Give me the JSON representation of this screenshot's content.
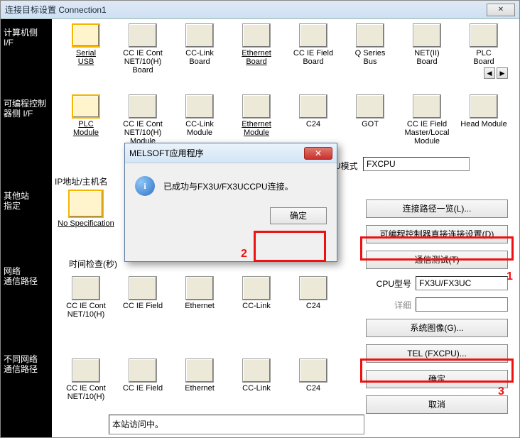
{
  "window": {
    "title": "连接目标设置 Connection1"
  },
  "labels": {
    "computer_if": "计算机侧\nI/F",
    "plc_if": "可编程控制器侧 I/F",
    "other_station": "其他站\n指定",
    "network_route": "网络\n通信路径",
    "diff_network": "不同网络\n通信路径"
  },
  "row1": [
    {
      "label": "Serial\nUSB",
      "selected": true,
      "underline": true
    },
    {
      "label": "CC IE Cont\nNET/10(H)\nBoard"
    },
    {
      "label": "CC-Link\nBoard"
    },
    {
      "label": "Ethernet\nBoard",
      "underline": true
    },
    {
      "label": "CC IE Field\nBoard"
    },
    {
      "label": "Q Series\nBus"
    },
    {
      "label": "NET(II)\nBoard"
    },
    {
      "label": "PLC\nBoard"
    }
  ],
  "row2": [
    {
      "label": "PLC\nModule",
      "underline": true,
      "selected": true
    },
    {
      "label": "CC IE Cont\nNET/10(H)\nModule"
    },
    {
      "label": "CC-Link\nModule"
    },
    {
      "label": "Ethernet\nModule",
      "underline": true
    },
    {
      "label": "C24"
    },
    {
      "label": "GOT"
    },
    {
      "label": "CC IE Field\nMaster/Local\nModule"
    },
    {
      "label": "Head Module"
    }
  ],
  "row3": [
    {
      "label": "No Specification",
      "underline": true,
      "selected": true
    }
  ],
  "row4": [
    {
      "label": "CC IE Cont\nNET/10(H)"
    },
    {
      "label": "CC IE Field"
    },
    {
      "label": "Ethernet"
    },
    {
      "label": "CC-Link"
    },
    {
      "label": "C24"
    }
  ],
  "row5": [
    {
      "label": "CC IE Cont\nNET/10(H)"
    },
    {
      "label": "CC IE Field"
    },
    {
      "label": "Ethernet"
    },
    {
      "label": "CC-Link"
    },
    {
      "label": "C24"
    }
  ],
  "fields": {
    "ip_label": "IP地址/主机名",
    "cpu_mode_label": "PU模式",
    "cpu_mode_value": "FXCPU",
    "time_check_label": "时间检查(秒)"
  },
  "right": {
    "conn_route_list": "连接路径一览(L)...",
    "plc_direct_conn": "可编程控制器直接连接设置(D)",
    "comm_test": "通信测试(T)",
    "cpu_model_label": "CPU型号",
    "cpu_model_value": "FX3U/FX3UC",
    "detail_label": "详细",
    "sys_image": "系统图像(G)...",
    "tel": "TEL (FXCPU)...",
    "ok": "确定",
    "cancel": "取消"
  },
  "dialog": {
    "title": "MELSOFT应用程序",
    "message": "已成功与FX3U/FX3UCCPU连接。",
    "ok": "确定"
  },
  "bottom": {
    "text": "本站访问中。"
  },
  "annotations": {
    "n1": "1",
    "n2": "2",
    "n3": "3"
  }
}
